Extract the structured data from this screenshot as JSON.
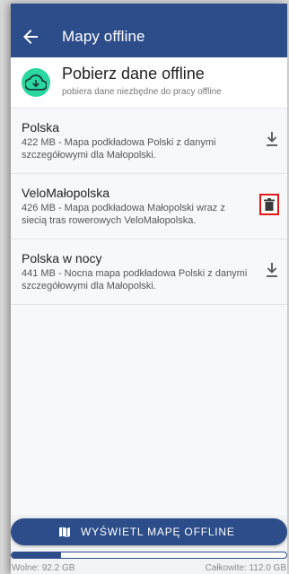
{
  "appbar": {
    "title": "Mapy offline",
    "back_icon": "arrow-left-icon"
  },
  "download_header": {
    "title": "Pobierz dane offline",
    "subtitle": "pobiera dane niezbędne do pracy offline",
    "icon": "cloud-download-icon",
    "icon_color": "#2ad7a0"
  },
  "maps": [
    {
      "name": "Polska",
      "description": "422 MB - Mapa podkładowa Polski z danymi szczegółowymi dla Małopolski.",
      "action": "download-icon"
    },
    {
      "name": "VeloMałopolska",
      "description": "426 MB - Mapa podkładowa Małopolski wraz z siecią tras rowerowych VeloMałopolska.",
      "action": "trash-icon"
    },
    {
      "name": "Polska w nocy",
      "description": "441 MB - Nocna mapa podkładowa Polski z danymi szczegółowymi dla Małopolski.",
      "action": "download-icon"
    }
  ],
  "footer": {
    "button_label": "WYŚWIETL MAPĘ OFFLINE",
    "button_icon": "map-icon",
    "storage_used_fraction": 0.18,
    "free_label": "Wolne: 92.2 GB",
    "total_label": "Całkowite: 112.0 GB"
  },
  "colors": {
    "primary": "#2c4d8a",
    "accent": "#2ad7a0",
    "highlight": "#e01818"
  }
}
